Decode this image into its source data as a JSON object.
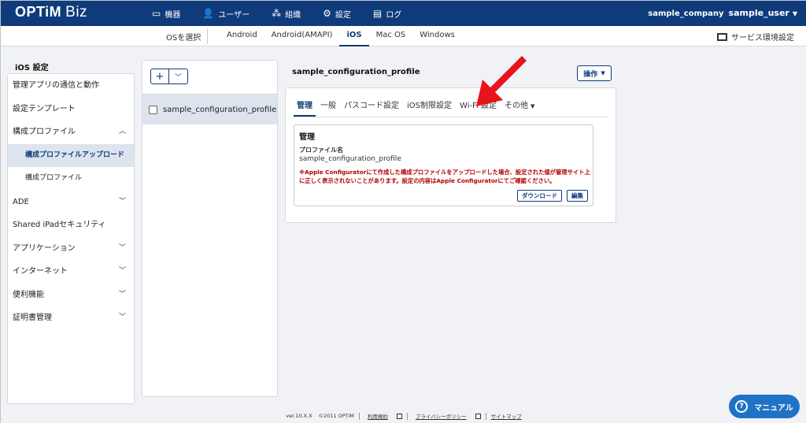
{
  "header": {
    "logo": "OPTiM",
    "logo_suffix": "Biz",
    "nav": [
      {
        "label": "機器",
        "icon": "device-icon"
      },
      {
        "label": "ユーザー",
        "icon": "user-icon"
      },
      {
        "label": "組織",
        "icon": "org-icon"
      },
      {
        "label": "設定",
        "icon": "gear-icon",
        "active": true
      },
      {
        "label": "ログ",
        "icon": "log-icon"
      }
    ],
    "company": "sample_company",
    "user": "sample_user"
  },
  "subbar": {
    "os_select": "OSを選択",
    "tabs": [
      "Android",
      "Android(AMAPI)",
      "iOS",
      "Mac OS",
      "Windows"
    ],
    "active_tab": "iOS",
    "service_settings": "サービス環境設定"
  },
  "sidebar": {
    "title": "iOS 設定",
    "items": [
      {
        "label": "管理アプリの通信と動作"
      },
      {
        "label": "設定テンプレート"
      },
      {
        "label": "構成プロファイル",
        "chevron": "up"
      },
      {
        "label": "構成プロファイルアップロード",
        "sub": true,
        "selected": true
      },
      {
        "label": "構成プロファイル",
        "sub": true
      },
      {
        "label": "ADE",
        "chevron": "down"
      },
      {
        "label": "Shared iPadセキュリティ"
      },
      {
        "label": "アプリケーション",
        "chevron": "down"
      },
      {
        "label": "インターネット",
        "chevron": "down"
      },
      {
        "label": "便利機能",
        "chevron": "down"
      },
      {
        "label": "証明書管理",
        "chevron": "down"
      }
    ]
  },
  "list": {
    "add_label": "+",
    "items": [
      "sample_configuration_profile"
    ]
  },
  "profile": {
    "title": "sample_configuration_profile",
    "operation_label": "操作",
    "tabs": [
      "管理",
      "一般",
      "パスコード設定",
      "iOS制限設定",
      "Wi-Fi 設定",
      "その他"
    ],
    "active_tab": "管理",
    "section_heading": "管理",
    "profile_name_label": "プロファイル名",
    "profile_name_value": "sample_configuration_profile",
    "note": "※Apple Configuratorにて作成した構成プロファイルをアップロードした場合、設定された値が管理サイト上に正しく表示されないことがあります。設定の内容はApple Configuratorにてご確認ください。",
    "download_label": "ダウンロード",
    "edit_label": "編集"
  },
  "footer": {
    "version": "ver.10.X.X",
    "copyright": "©2011 OPTiM",
    "terms": "利用規約",
    "privacy": "プライバシーポリシー",
    "sitemap": "サイトマップ"
  },
  "manual_button": "マニュアル",
  "colors": {
    "primary": "#0f3b7a",
    "accent_arrow": "#e8141b",
    "note_red": "#b30000",
    "manual_blue": "#1f73c4"
  }
}
